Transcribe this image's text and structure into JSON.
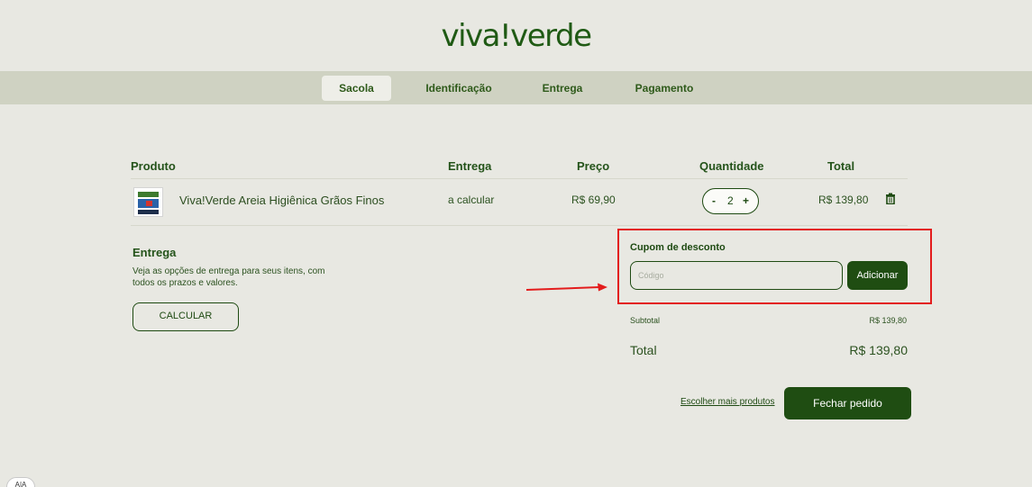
{
  "brand": {
    "logo_text": "viva!verde"
  },
  "steps": [
    {
      "label": "Sacola",
      "active": true
    },
    {
      "label": "Identificação"
    },
    {
      "label": "Entrega"
    },
    {
      "label": "Pagamento"
    }
  ],
  "cart": {
    "headers": {
      "product": "Produto",
      "delivery": "Entrega",
      "price": "Preço",
      "quantity": "Quantidade",
      "total": "Total"
    },
    "items": [
      {
        "name": "Viva!Verde Areia Higiênica Grãos Finos",
        "delivery": "a calcular",
        "price": "R$ 69,90",
        "quantity": "2",
        "total": "R$ 139,80"
      }
    ]
  },
  "delivery": {
    "title": "Entrega",
    "description": "Veja as opções de entrega para seus itens, com todos os prazos e valores.",
    "button": "CALCULAR"
  },
  "coupon": {
    "title": "Cupom de desconto",
    "placeholder": "Código",
    "button": "Adicionar"
  },
  "summary": {
    "subtotal_label": "Subtotal",
    "subtotal_value": "R$ 139,80",
    "total_label": "Total",
    "total_value": "R$ 139,80"
  },
  "actions": {
    "more_products": "Escolher mais produtos",
    "checkout": "Fechar pedido"
  },
  "accessibility": {
    "label": "A|A"
  },
  "colors": {
    "brand_green": "#1f4d12",
    "background": "#e8e8e2",
    "steps_bar": "#cfd2c2",
    "highlight_red": "#e31c1c"
  }
}
